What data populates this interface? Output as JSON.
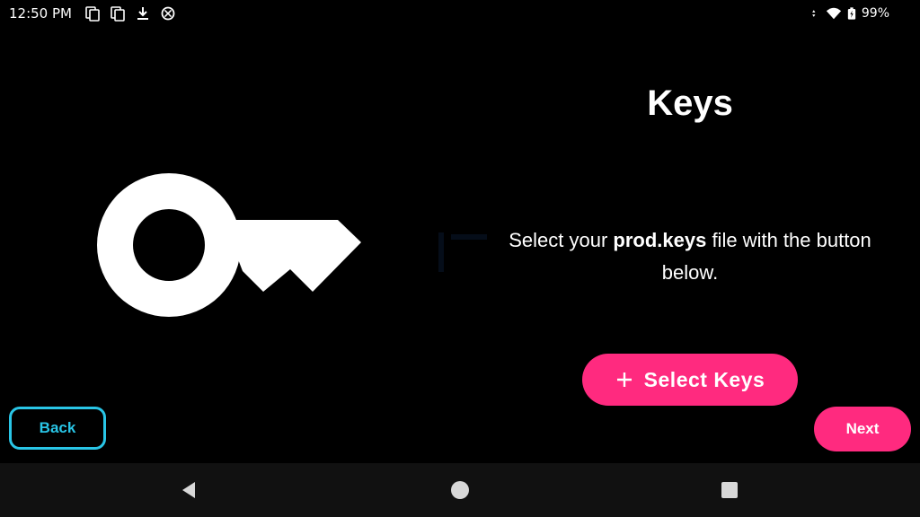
{
  "status_bar": {
    "time": "12:50 PM",
    "left_icons": [
      "copy-icon",
      "copy-icon",
      "download-icon",
      "sync-icon"
    ],
    "right_icons": [
      "data-arrows-icon",
      "wifi-icon",
      "battery-charging-icon"
    ],
    "battery": "99%"
  },
  "page": {
    "title": "Keys",
    "description_prefix": "Select your ",
    "description_bold": "prod.keys",
    "description_suffix": " file with the button below.",
    "illustration": "key-icon"
  },
  "buttons": {
    "select_keys": "Select Keys",
    "back": "Back",
    "next": "Next"
  },
  "nav_bar": {
    "items": [
      "back-triangle-icon",
      "home-circle-icon",
      "recents-square-icon"
    ]
  },
  "colors": {
    "background": "#000000",
    "accent_pink": "#ff2a7f",
    "accent_cyan": "#29c5e6",
    "text": "#ffffff",
    "nav_bar": "#111111"
  }
}
